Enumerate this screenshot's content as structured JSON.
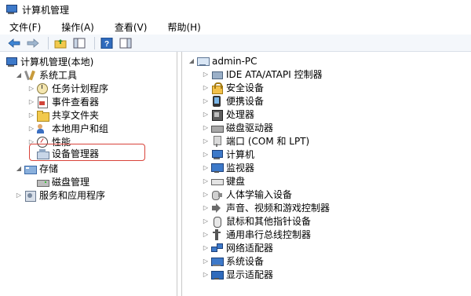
{
  "window": {
    "title": "计算机管理"
  },
  "menu": {
    "file": "文件(F)",
    "action": "操作(A)",
    "view": "查看(V)",
    "help": "帮助(H)"
  },
  "tree": {
    "root": "计算机管理(本地)",
    "system_tools": "系统工具",
    "task_scheduler": "任务计划程序",
    "event_viewer": "事件查看器",
    "shared_folders": "共享文件夹",
    "local_users": "本地用户和组",
    "performance": "性能",
    "device_manager": "设备管理器",
    "storage": "存储",
    "disk_management": "磁盘管理",
    "services_apps": "服务和应用程序"
  },
  "devices": {
    "computer_name": "admin-PC",
    "items": [
      "IDE ATA/ATAPI 控制器",
      "安全设备",
      "便携设备",
      "处理器",
      "磁盘驱动器",
      "端口 (COM 和 LPT)",
      "计算机",
      "监视器",
      "键盘",
      "人体学输入设备",
      "声音、视频和游戏控制器",
      "鼠标和其他指针设备",
      "通用串行总线控制器",
      "网络适配器",
      "系统设备",
      "显示适配器"
    ],
    "icons": [
      "ide-controller-icon",
      "security-device-icon",
      "portable-device-icon",
      "processor-icon",
      "disk-drive-icon",
      "port-icon",
      "computer-icon",
      "monitor-icon",
      "keyboard-icon",
      "hid-icon",
      "audio-icon",
      "mouse-icon",
      "usb-icon",
      "network-adapter-icon",
      "system-device-icon",
      "display-adapter-icon"
    ]
  },
  "colors": {
    "highlight_border": "#d9433a",
    "toolbar_bg": "#f4f7fb"
  }
}
